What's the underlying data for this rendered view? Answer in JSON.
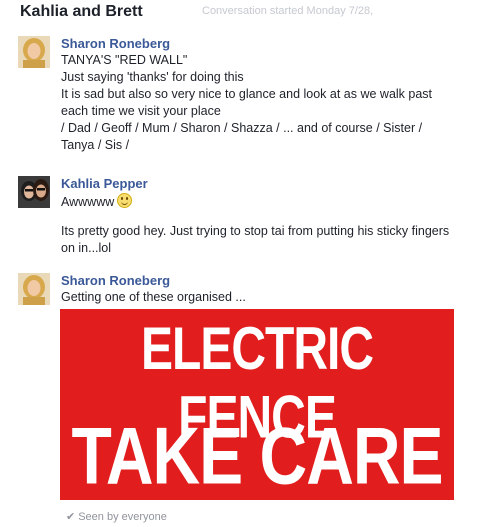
{
  "header": {
    "title": "Kahlia and Brett",
    "started": "Conversation started Monday 7/28,"
  },
  "messages": [
    {
      "name": "Sharon Roneberg",
      "lines": [
        "TANYA'S  \"RED  WALL\"",
        "Just saying 'thanks' for doing this",
        "It is sad but also so very nice to glance and look at as we walk past",
        "each time we visit your place",
        "/ Dad / Geoff / Mum / Sharon / Shazza / ... and of course / Sister /",
        "Tanya / Sis /"
      ]
    },
    {
      "name": "Kahlia Pepper",
      "lines": [
        "Awwwww",
        "Its pretty good hey. Just trying to stop tai from putting his sticky fingers",
        "on in...lol"
      ]
    },
    {
      "name": "Sharon Roneberg",
      "lines": [
        "Getting one of these organised ..."
      ],
      "image": {
        "line1": "ELECTRIC FENCE",
        "line2": "TAKE CARE"
      }
    }
  ],
  "status": {
    "seen": "Seen by everyone"
  },
  "colors": {
    "name_link": "#3b5998",
    "sign_red": "#e11d1d",
    "muted": "#90949c"
  }
}
